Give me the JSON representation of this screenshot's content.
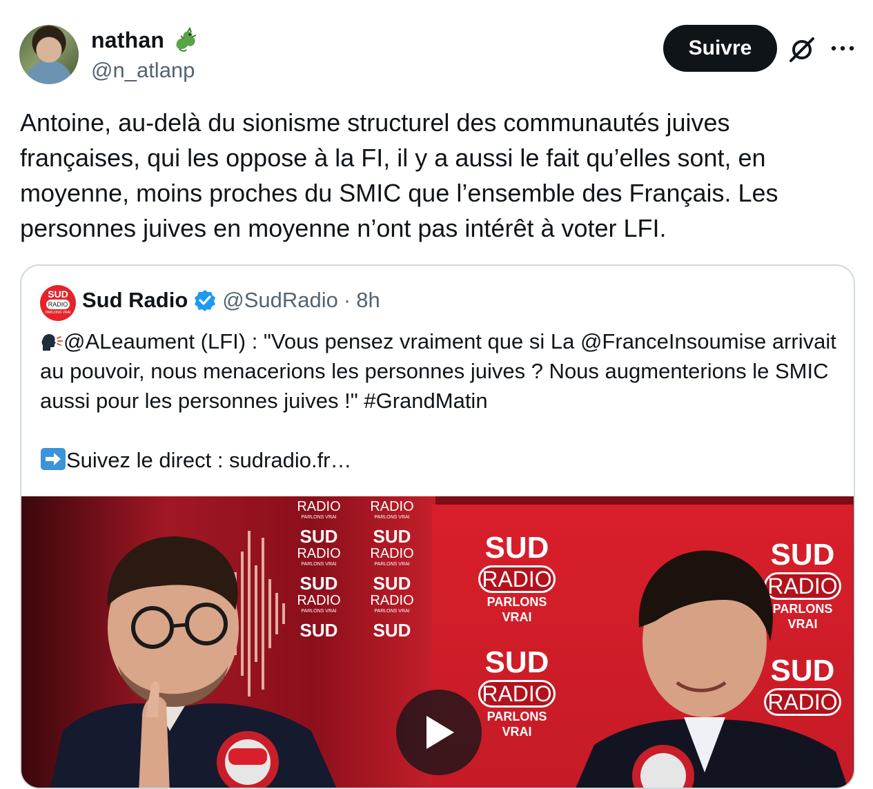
{
  "author": {
    "display_name": "nathan",
    "handle": "@n_atlanp"
  },
  "actions": {
    "follow_label": "Suivre"
  },
  "tweet": {
    "text": "Antoine, au-delà du sionisme structurel des communautés juives françaises, qui les oppose à la FI, il y a aussi le fait qu’elles sont, en moyenne, moins proches du SMIC que l’ensemble des Français. Les personnes juives en moyenne n’ont pas intérêt à voter LFI."
  },
  "quote": {
    "name": "Sud Radio",
    "handle": "@SudRadio",
    "separator": "·",
    "time": "8h",
    "avatar_text": {
      "line1": "SUD",
      "line2": "RADIO",
      "line3": "PARLONS VRAI"
    },
    "text_line1": "@ALeaument (LFI) : \"Vous pensez vraiment que si La @FranceInsoumise arrivait au pouvoir, nous menacerions les personnes juives ? Nous augmenterions le SMIC aussi pour les personnes juives !\" #GrandMatin",
    "text_line2": "Suivez le direct : sudradio.fr…",
    "media": {
      "logo_sud": "SUD",
      "logo_radio": "RADIO",
      "logo_tagline": "PARLONS VRAI"
    }
  },
  "colors": {
    "follow_bg": "#0f1419",
    "verified": "#1d9bf0",
    "brand_red": "#d91f2b",
    "secondary_text": "#536471"
  }
}
